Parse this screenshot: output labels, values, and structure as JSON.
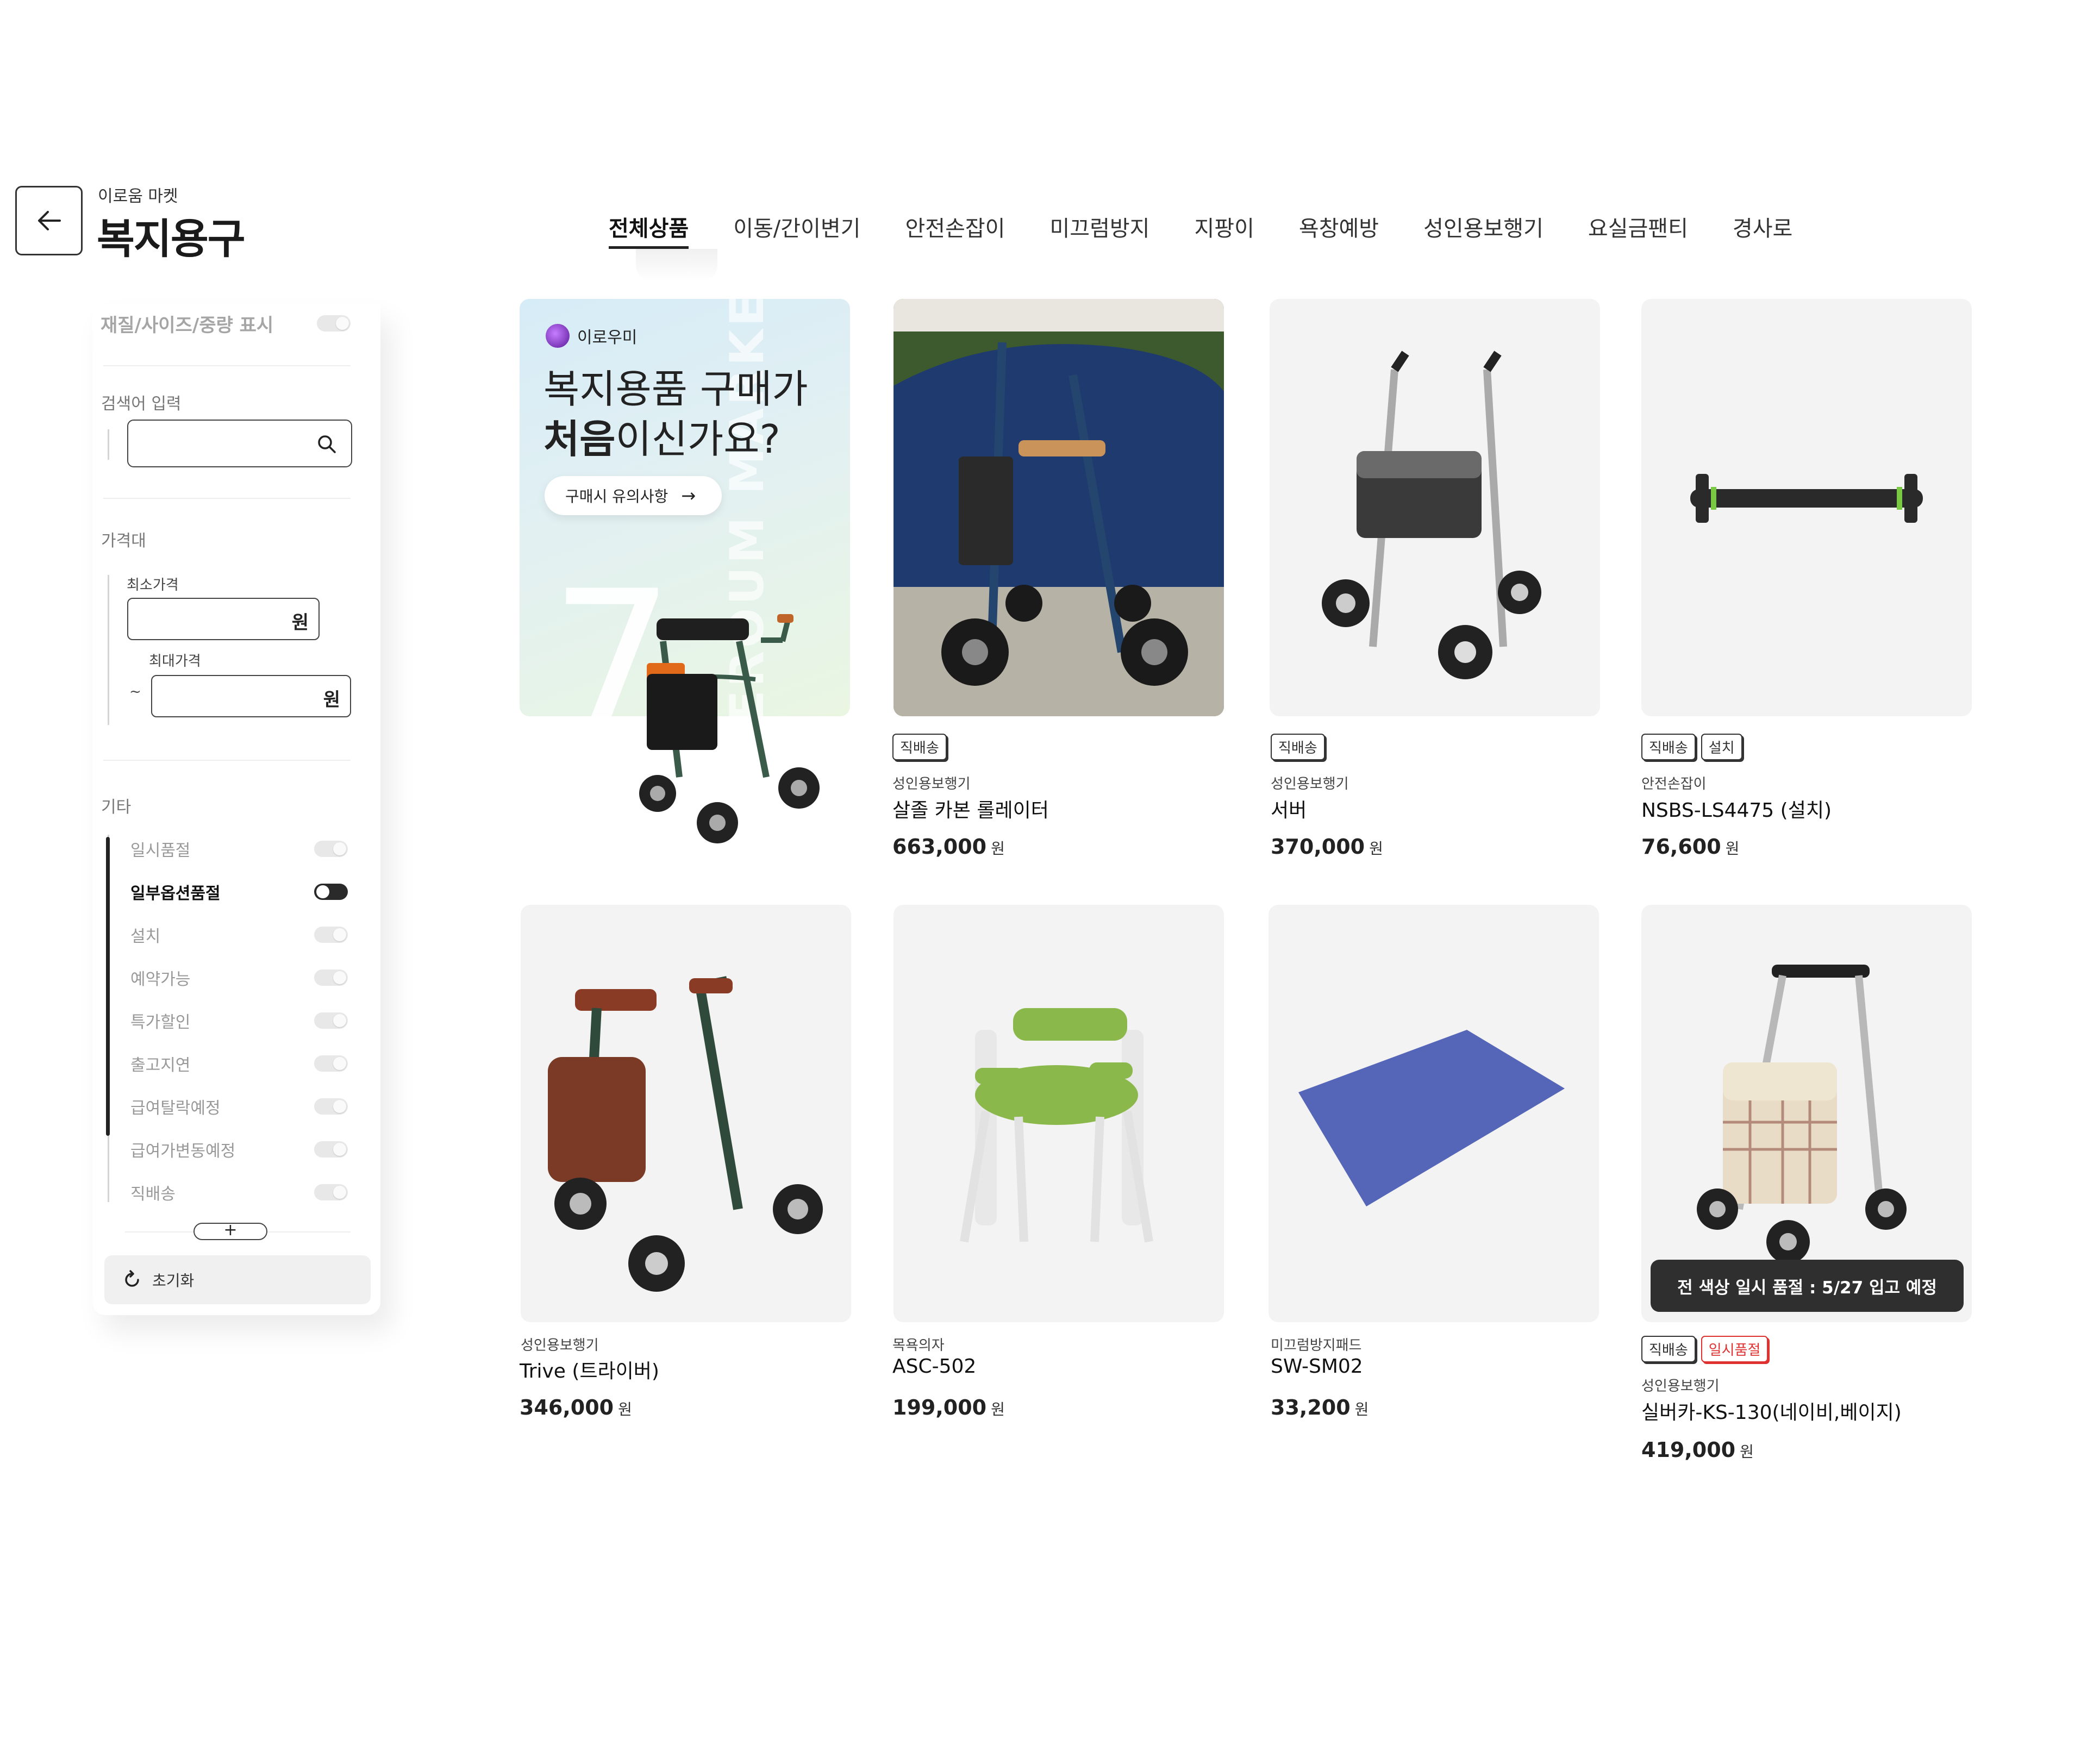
{
  "header": {
    "brand_sub": "이로움 마켓",
    "brand_title": "복지용구"
  },
  "tabs": [
    {
      "label": "전체상품",
      "active": true
    },
    {
      "label": "이동/간이변기"
    },
    {
      "label": "안전손잡이"
    },
    {
      "label": "미끄럼방지"
    },
    {
      "label": "지팡이"
    },
    {
      "label": "욕창예방"
    },
    {
      "label": "성인용보행기"
    },
    {
      "label": "요실금팬티"
    },
    {
      "label": "경사로"
    }
  ],
  "sidebar": {
    "display_toggle_label": "재질/사이즈/중량 표시",
    "search_label": "검색어 입력",
    "search_value": "",
    "price_section": "가격대",
    "min_price_label": "최소가격",
    "max_price_label": "최대가격",
    "currency_unit": "원",
    "tilde": "~",
    "other_section": "기타",
    "options": [
      {
        "label": "일시품절",
        "on": false
      },
      {
        "label": "일부옵션품절",
        "on": true
      },
      {
        "label": "설치",
        "on": false
      },
      {
        "label": "예약가능",
        "on": false
      },
      {
        "label": "특가할인",
        "on": false
      },
      {
        "label": "출고지연",
        "on": false
      },
      {
        "label": "급여탈락예정",
        "on": false
      },
      {
        "label": "급여가변동예정",
        "on": false
      },
      {
        "label": "직배송",
        "on": false
      }
    ],
    "more_label": "+",
    "reset_label": "초기화"
  },
  "banner": {
    "brand": "이로우미",
    "title_line1": "복지용품 구매가",
    "title_bold": "처음",
    "title_rest": "이신가요?",
    "button_label": "구매시 유의사항",
    "button_arrow": "→",
    "watermark": "EROUM MARKET",
    "big_number": "7"
  },
  "products": [
    {
      "badges": [
        {
          "label": "직배송"
        }
      ],
      "category": "성인용보행기",
      "name": "살졸 카본 롤레이터",
      "price": "663,000",
      "unit": "원"
    },
    {
      "badges": [
        {
          "label": "직배송"
        }
      ],
      "category": "성인용보행기",
      "name": "서버",
      "price": "370,000",
      "unit": "원"
    },
    {
      "badges": [
        {
          "label": "직배송"
        },
        {
          "label": "설치"
        }
      ],
      "category": "안전손잡이",
      "name": "NSBS-LS4475 (설치)",
      "price": "76,600",
      "unit": "원"
    },
    {
      "badges": [],
      "category": "성인용보행기",
      "name": "Trive (트라이버)",
      "price": "346,000",
      "unit": "원"
    },
    {
      "badges": [],
      "category": "목욕의자",
      "name": "ASC-502",
      "price": "199,000",
      "unit": "원"
    },
    {
      "badges": [],
      "category": "미끄럼방지패드",
      "name": "SW-SM02",
      "price": "33,200",
      "unit": "원"
    },
    {
      "badges": [
        {
          "label": "직배송"
        },
        {
          "label": "일시품절",
          "red": true
        }
      ],
      "category": "성인용보행기",
      "name": "실버카-KS-130(네이비,베이지)",
      "price": "419,000",
      "unit": "원",
      "overlay": "전 색상 일시 품절 : 5/27 입고 예정"
    }
  ]
}
